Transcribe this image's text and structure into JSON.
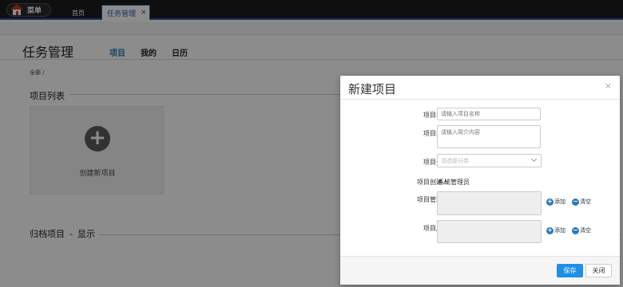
{
  "topbar": {
    "menu_label": "菜单",
    "tabs": [
      {
        "label": "首页"
      },
      {
        "label": "任务管理",
        "close": "×"
      }
    ]
  },
  "page": {
    "title": "任务管理",
    "nav": [
      "项目",
      "我的",
      "日历"
    ],
    "breadcrumb": "全部 /",
    "project_list_title": "项目列表",
    "create_card_label": "创建新项目",
    "archive_title": "归档项目",
    "archive_dash": "-",
    "archive_toggle": "显示"
  },
  "modal": {
    "title": "新建项目",
    "close": "×",
    "fields": {
      "name_label": "项目名称",
      "name_placeholder": "请输入项目名称",
      "intro_label": "项目简介",
      "intro_placeholder": "请输入简介内容",
      "category_label": "项目分类",
      "category_placeholder": "请选择分类",
      "creator_label": "项目创建人",
      "creator_value": "系统管理员",
      "managers_label": "项目管理员",
      "members_label": "项目成员"
    },
    "actions": {
      "add": "添加",
      "clear": "清空",
      "add_sign": "+",
      "clear_sign": "−"
    },
    "buttons": {
      "save": "保存",
      "close": "关闭"
    }
  },
  "colors": {
    "accent": "#1e90e6",
    "nav_active": "#2a7ab8",
    "topbar": "#1c1c1c"
  }
}
